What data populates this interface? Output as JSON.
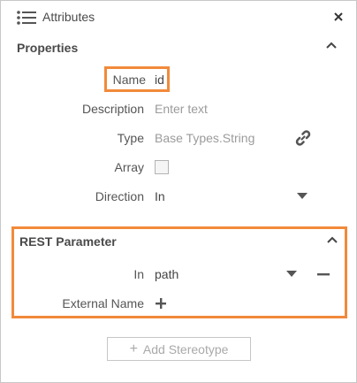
{
  "header": {
    "title": "Attributes",
    "icon": "list-icon",
    "close_icon": "close-icon"
  },
  "properties": {
    "title": "Properties",
    "name_label": "Name",
    "name_value": "id",
    "description_label": "Description",
    "description_placeholder": "Enter text",
    "type_label": "Type",
    "type_value": "Base Types.String",
    "array_label": "Array",
    "array_checked": false,
    "direction_label": "Direction",
    "direction_value": "In"
  },
  "rest_parameter": {
    "title": "REST Parameter",
    "in_label": "In",
    "in_value": "path",
    "external_name_label": "External Name"
  },
  "footer": {
    "add_stereotype_label": "Add Stereotype"
  },
  "colors": {
    "highlight": "#f28a3a",
    "text": "#4a4a4a",
    "placeholder": "#9b9b9b"
  }
}
